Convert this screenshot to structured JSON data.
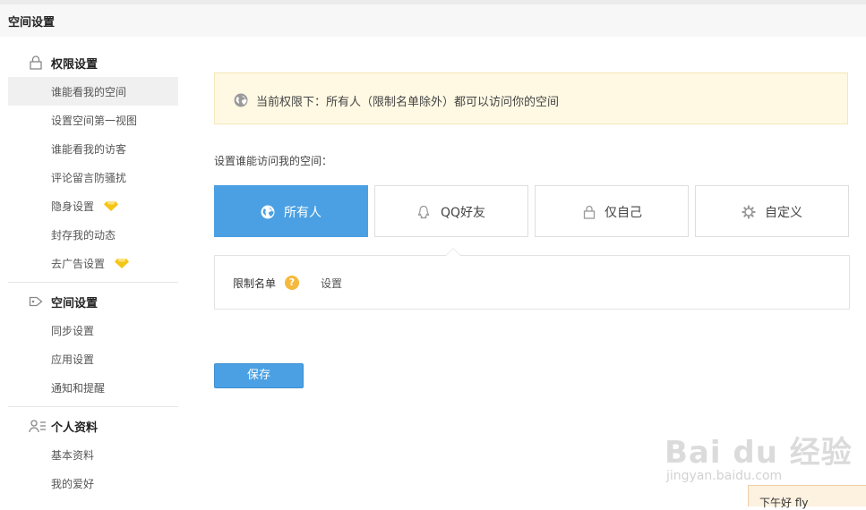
{
  "header": {
    "title": "空间设置"
  },
  "sidebar": {
    "sections": [
      {
        "label": "权限设置",
        "icon": "lock-icon",
        "items": [
          {
            "label": "谁能看我的空间",
            "active": true
          },
          {
            "label": "设置空间第一视图"
          },
          {
            "label": "谁能看我的访客"
          },
          {
            "label": "评论留言防骚扰"
          },
          {
            "label": "隐身设置",
            "badge": "diamond-icon"
          },
          {
            "label": "封存我的动态"
          },
          {
            "label": "去广告设置",
            "badge": "diamond-icon"
          }
        ]
      },
      {
        "label": "空间设置",
        "icon": "tag-icon",
        "items": [
          {
            "label": "同步设置"
          },
          {
            "label": "应用设置"
          },
          {
            "label": "通知和提醒"
          }
        ]
      },
      {
        "label": "个人资料",
        "icon": "profile-icon",
        "items": [
          {
            "label": "基本资料"
          },
          {
            "label": "我的爱好"
          }
        ]
      }
    ]
  },
  "notice": {
    "text": "当前权限下：所有人（限制名单除外）都可以访问你的空间",
    "icon": "globe-icon"
  },
  "access": {
    "label": "设置谁能访问我的空间：",
    "options": [
      {
        "label": "所有人",
        "icon": "globe-icon",
        "selected": true
      },
      {
        "label": "QQ好友",
        "icon": "qq-penguin-icon"
      },
      {
        "label": "仅自己",
        "icon": "lock-icon"
      },
      {
        "label": "自定义",
        "icon": "gear-icon"
      }
    ]
  },
  "restrict": {
    "label": "限制名单",
    "help": "?",
    "link": "设置"
  },
  "save_label": "保存",
  "watermark": {
    "main": "Bai du 经验",
    "sub": "jingyan.baidu.com"
  },
  "toast": {
    "text": "下午好 fly"
  },
  "colors": {
    "accent": "#4aa0e3",
    "notice_bg": "#fff9e3",
    "diamond": "#f5c518",
    "help": "#f5b93d"
  }
}
